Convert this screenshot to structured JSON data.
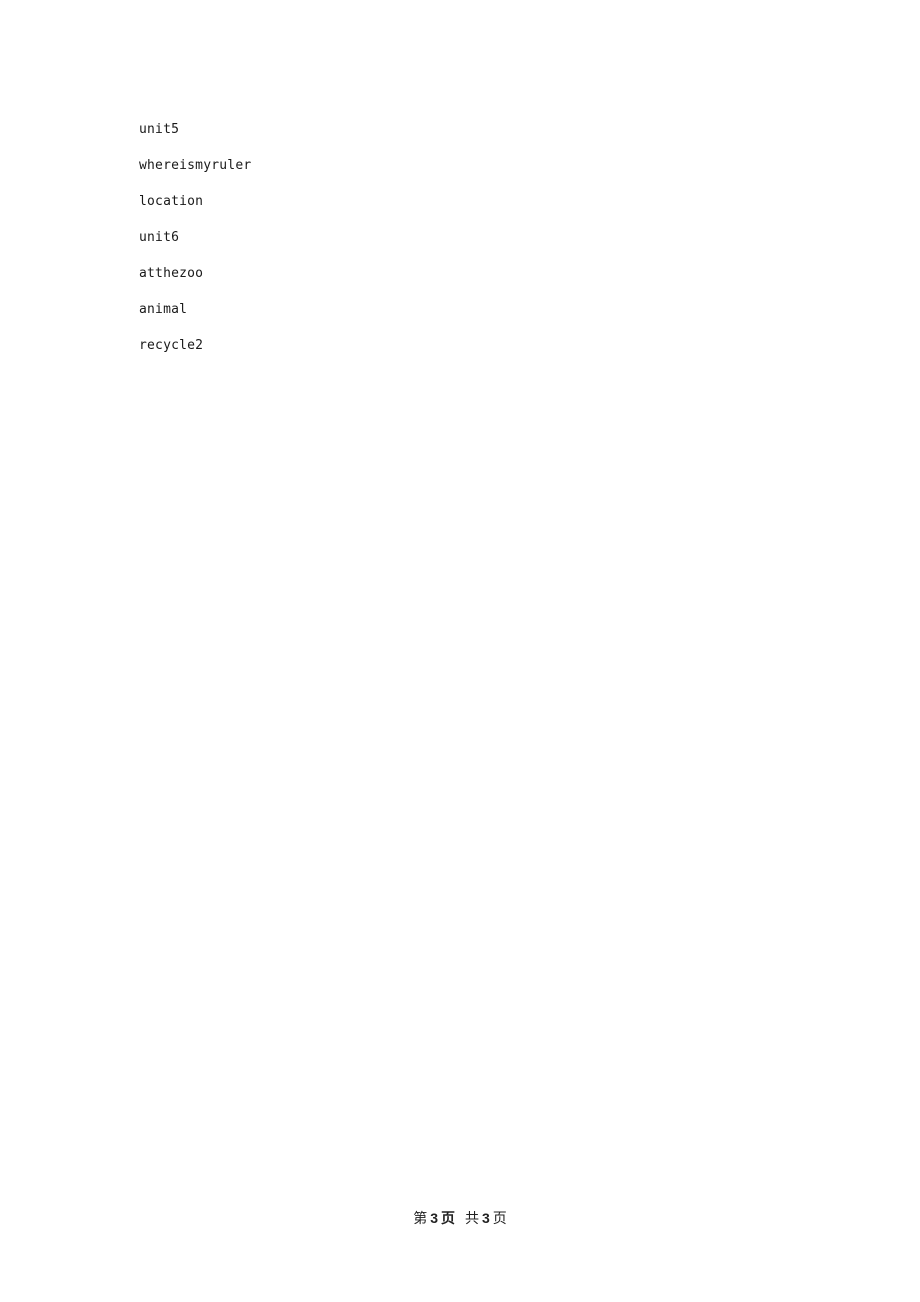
{
  "document": {
    "lines": [
      "unit5",
      "whereismyruler",
      "location",
      "unit6",
      "atthezoo",
      "animal",
      "recycle2"
    ]
  },
  "footer": {
    "prefix": "第",
    "current_page": "3",
    "page_label": "页",
    "total_prefix": "共",
    "total_pages": "3",
    "total_suffix": "页"
  }
}
